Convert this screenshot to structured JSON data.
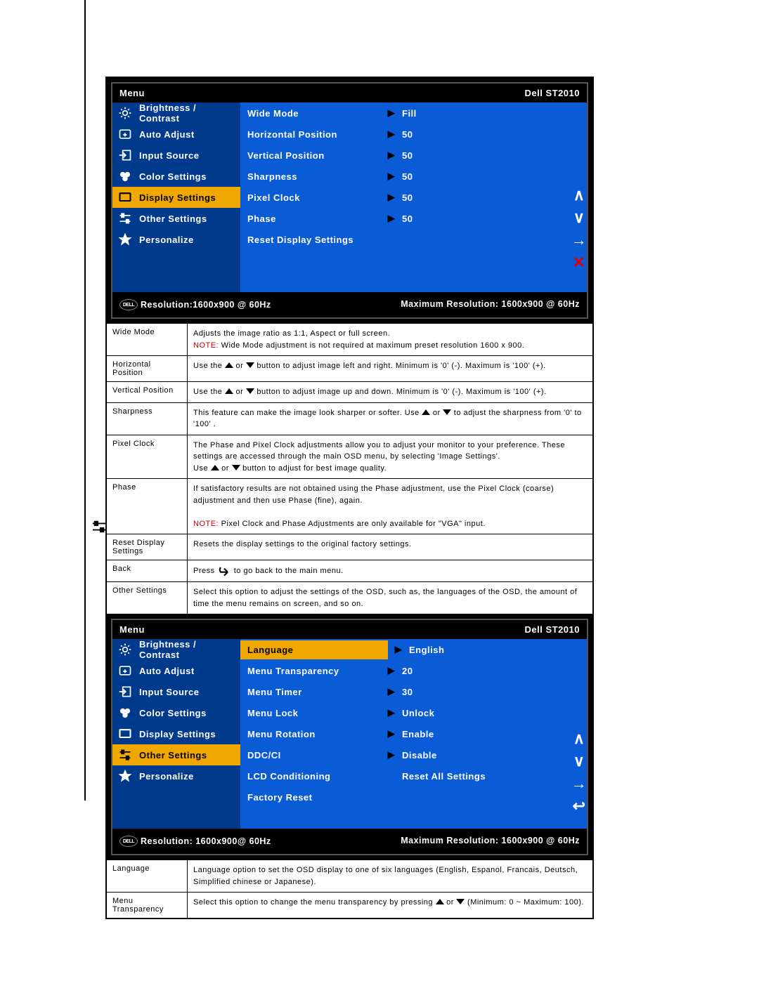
{
  "doc": {
    "col_labels": {
      "wide_mode": "Wide Mode",
      "horizontal_position": "Horizontal Position",
      "vertical_position": "Vertical Position",
      "sharpness": "Sharpness",
      "pixel_clock": "Pixel Clock",
      "phase": "Phase",
      "reset_display_settings": "Reset Display Settings",
      "back": "Back",
      "other_settings": "Other Settings",
      "language": "Language",
      "menu_transparency": "Menu Transparency"
    },
    "text": {
      "wide_mode_1": "Adjusts the image ratio as 1:1, Aspect or full screen.",
      "wide_mode_note_prefix": "NOTE:",
      "wide_mode_note": " Wide Mode adjustment is not required at maximum preset resolution 1600 x 900.",
      "hpos_a": "Use the ",
      "hpos_b": " or ",
      "hpos_c": " button to adjust image left and right. Minimum is '0' (-). Maximum is '100' (+).",
      "vpos_a": "Use the ",
      "vpos_b": " or ",
      "vpos_c": " button to adjust image up and down. Minimum is '0' (-). Maximum is '100' (+).",
      "sharp_a": "This feature can make the image look sharper or softer. Use ",
      "sharp_b": " or ",
      "sharp_c": " to adjust the sharpness from '0' to '100' .",
      "pixel_clock_1": "The Phase and Pixel Clock adjustments allow you to adjust your monitor to your preference. These settings are accessed through the main OSD menu, by selecting 'Image Settings'.",
      "pixel_clock_2a": "Use ",
      "pixel_clock_2b": " or ",
      "pixel_clock_2c": " button to adjust for best image quality.",
      "phase_1": "If satisfactory results are not obtained using the Phase adjustment, use the Pixel Clock (coarse) adjustment and then use Phase (fine), again.",
      "phase_note_prefix": "NOTE:",
      "phase_note": " Pixel Clock and Phase Adjustments are only available for \"VGA\" input.",
      "reset_display": "Resets the display settings to the original factory settings.",
      "back_a": "Press ",
      "back_b": " to go back to the main menu.",
      "other_settings": "Select this option to adjust the settings of the OSD, such as, the languages of the OSD, the amount of time the menu remains on screen, and so on.",
      "language": "Language option to set the OSD display to one of six languages (English, Espanol, Francais, Deutsch, Simplified chinese or Japanese).",
      "menu_trans_a": "Select this option to change the menu transparency by pressing ",
      "menu_trans_b": " or ",
      "menu_trans_c": " (Minimum: 0 ~ Maximum: 100)."
    }
  },
  "osd1": {
    "title": "Menu",
    "model": "Dell ST2010",
    "menu": [
      {
        "label": "Brightness / Contrast"
      },
      {
        "label": "Auto Adjust"
      },
      {
        "label": "Input Source"
      },
      {
        "label": "Color Settings"
      },
      {
        "label": "Display Settings"
      },
      {
        "label": "Other Settings"
      },
      {
        "label": "Personalize"
      }
    ],
    "selected_menu_index": 4,
    "sub": [
      {
        "label": "Wide Mode",
        "value": "Fill",
        "arrow": true
      },
      {
        "label": "Horizontal Position",
        "value": "50",
        "arrow": true
      },
      {
        "label": "Vertical Position",
        "value": "50",
        "arrow": true
      },
      {
        "label": "Sharpness",
        "value": "50",
        "arrow": true
      },
      {
        "label": "Pixel Clock",
        "value": "50",
        "arrow": true
      },
      {
        "label": "Phase",
        "value": "50",
        "arrow": true
      },
      {
        "label": "Reset Display Settings",
        "value": "",
        "arrow": false
      }
    ],
    "foot_left": "Resolution:1600x900 @ 60Hz",
    "foot_right": "Maximum Resolution: 1600x900 @ 60Hz",
    "side_buttons": [
      "up",
      "down",
      "enter",
      "close"
    ]
  },
  "osd2": {
    "title": "Menu",
    "model": "Dell ST2010",
    "menu": [
      {
        "label": "Brightness / Contrast"
      },
      {
        "label": "Auto Adjust"
      },
      {
        "label": "Input Source"
      },
      {
        "label": "Color Settings"
      },
      {
        "label": "Display Settings"
      },
      {
        "label": "Other Settings"
      },
      {
        "label": "Personalize"
      }
    ],
    "selected_menu_index": 5,
    "sub": [
      {
        "label": "Language",
        "value": "English",
        "arrow": true,
        "selected": true
      },
      {
        "label": "Menu Transparency",
        "value": "20",
        "arrow": true
      },
      {
        "label": "Menu Timer",
        "value": "30",
        "arrow": true
      },
      {
        "label": "Menu Lock",
        "value": "Unlock",
        "arrow": true
      },
      {
        "label": "Menu Rotation",
        "value": "Enable",
        "arrow": true
      },
      {
        "label": "DDC/CI",
        "value": "Disable",
        "arrow": true
      },
      {
        "label": "LCD Conditioning",
        "value": "Reset All Settings",
        "arrow": false
      },
      {
        "label": "Factory Reset",
        "value": "",
        "arrow": false
      }
    ],
    "foot_left": "Resolution: 1600x900@ 60Hz",
    "foot_right": "Maximum Resolution: 1600x900 @ 60Hz",
    "side_buttons": [
      "up",
      "down",
      "enter",
      "back"
    ]
  }
}
